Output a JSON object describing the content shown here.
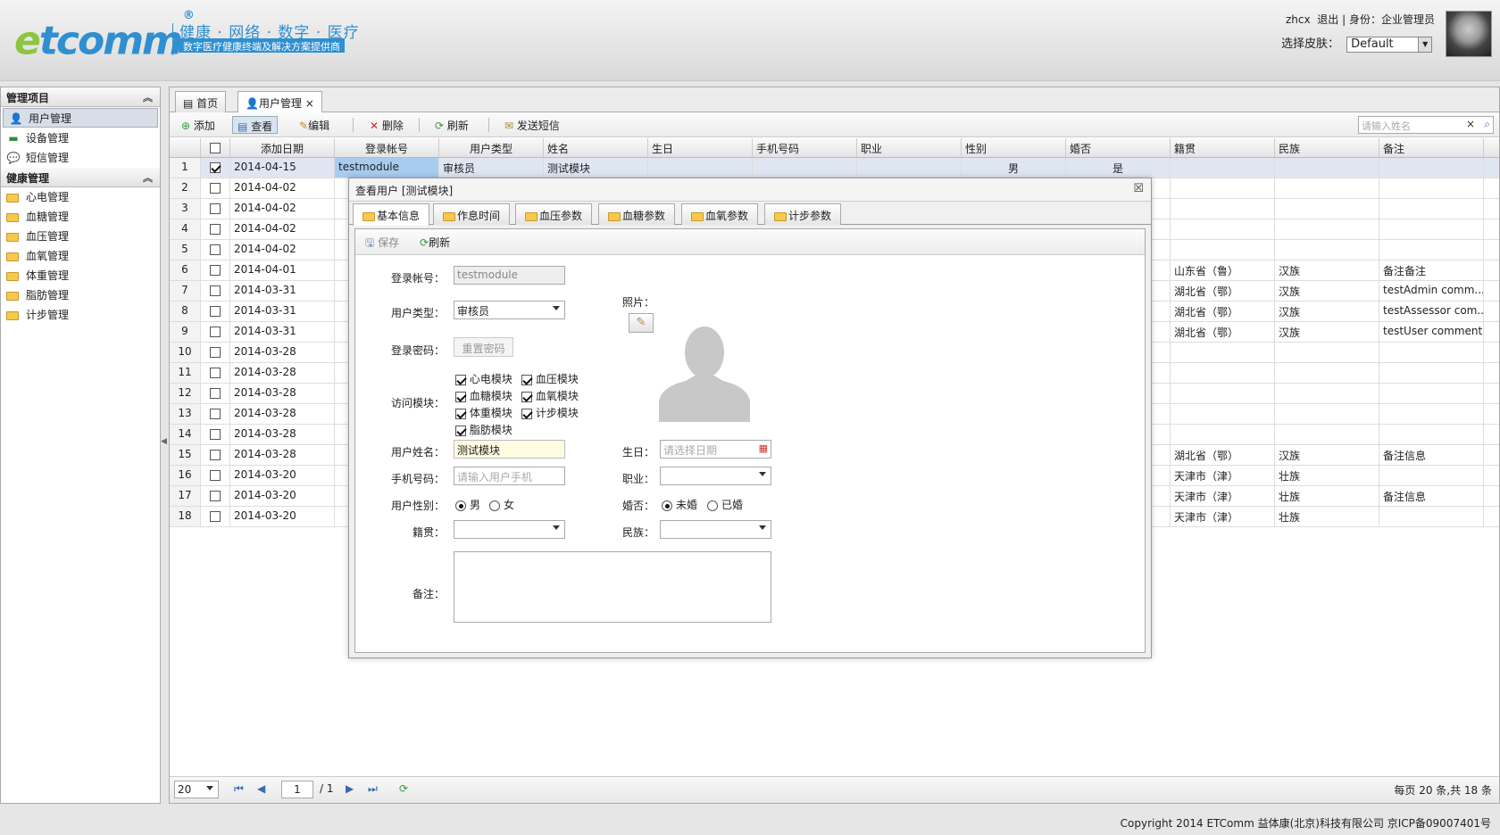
{
  "header": {
    "logo": {
      "e": "e",
      "rest": "tcomm",
      "reg": "®"
    },
    "slogan": "健康 · 网络 · 数字 · 医疗",
    "subslogan": "数字医疗健康终端及解决方案提供商",
    "username": "zhcx",
    "logout": "退出",
    "role_sep": "|",
    "role": "身份：企业管理员",
    "skin_label": "选择皮肤：",
    "skin_value": "Default"
  },
  "sidebar": {
    "section1": {
      "title": "管理项目",
      "items": [
        {
          "label": "用户管理",
          "icon": "user-icon"
        },
        {
          "label": "设备管理",
          "icon": "device-icon"
        },
        {
          "label": "短信管理",
          "icon": "sms-icon"
        }
      ]
    },
    "section2": {
      "title": "健康管理",
      "items": [
        {
          "label": "心电管理"
        },
        {
          "label": "血糖管理"
        },
        {
          "label": "血压管理"
        },
        {
          "label": "血氧管理"
        },
        {
          "label": "体重管理"
        },
        {
          "label": "脂肪管理"
        },
        {
          "label": "计步管理"
        }
      ]
    }
  },
  "tabs": [
    {
      "label": "首页"
    },
    {
      "label": "用户管理",
      "close": "×"
    }
  ],
  "toolbar": {
    "add": "添加",
    "view": "查看",
    "edit": "编辑",
    "delete": "删除",
    "refresh": "刷新",
    "sms": "发送短信",
    "search_placeholder": "请输入姓名",
    "clear": "×"
  },
  "grid": {
    "columns": [
      "添加日期",
      "登录帐号",
      "用户类型",
      "姓名",
      "生日",
      "手机号码",
      "职业",
      "性别",
      "婚否",
      "籍贯",
      "民族",
      "备注"
    ],
    "rows": [
      {
        "n": "1",
        "date": "2014-04-15",
        "account": "testmodule",
        "type": "审核员",
        "name": "测试模块",
        "gender": "男",
        "married": "是",
        "origin": "",
        "ethnic": "",
        "note": "",
        "checked": true
      },
      {
        "n": "2",
        "date": "2014-04-02",
        "origin": "",
        "ethnic": "",
        "note": ""
      },
      {
        "n": "3",
        "date": "2014-04-02",
        "origin": "",
        "ethnic": "",
        "note": ""
      },
      {
        "n": "4",
        "date": "2014-04-02",
        "origin": "",
        "ethnic": "",
        "note": ""
      },
      {
        "n": "5",
        "date": "2014-04-02",
        "origin": "",
        "ethnic": "",
        "note": ""
      },
      {
        "n": "6",
        "date": "2014-04-01",
        "origin": "山东省（鲁）",
        "ethnic": "汉族",
        "note": "备注备注"
      },
      {
        "n": "7",
        "date": "2014-03-31",
        "origin": "湖北省（鄂）",
        "ethnic": "汉族",
        "note": "testAdmin comm..."
      },
      {
        "n": "8",
        "date": "2014-03-31",
        "origin": "湖北省（鄂）",
        "ethnic": "汉族",
        "note": "testAssessor com..."
      },
      {
        "n": "9",
        "date": "2014-03-31",
        "origin": "湖北省（鄂）",
        "ethnic": "汉族",
        "note": "testUser comment"
      },
      {
        "n": "10",
        "date": "2014-03-28",
        "origin": "",
        "ethnic": "",
        "note": ""
      },
      {
        "n": "11",
        "date": "2014-03-28",
        "origin": "",
        "ethnic": "",
        "note": ""
      },
      {
        "n": "12",
        "date": "2014-03-28",
        "origin": "",
        "ethnic": "",
        "note": ""
      },
      {
        "n": "13",
        "date": "2014-03-28",
        "origin": "",
        "ethnic": "",
        "note": ""
      },
      {
        "n": "14",
        "date": "2014-03-28",
        "origin": "",
        "ethnic": "",
        "note": ""
      },
      {
        "n": "15",
        "date": "2014-03-28",
        "origin": "湖北省（鄂）",
        "ethnic": "汉族",
        "note": "备注信息"
      },
      {
        "n": "16",
        "date": "2014-03-20",
        "origin": "天津市（津）",
        "ethnic": "壮族",
        "note": ""
      },
      {
        "n": "17",
        "date": "2014-03-20",
        "origin": "天津市（津）",
        "ethnic": "壮族",
        "note": "备注信息"
      },
      {
        "n": "18",
        "date": "2014-03-20",
        "origin": "天津市（津）",
        "ethnic": "壮族",
        "note": ""
      }
    ]
  },
  "pager": {
    "page_size": "20",
    "current_page": "1",
    "total_pages": "/ 1",
    "summary": "每页 20 条,共 18 条"
  },
  "dialog": {
    "title": "查看用户 [测试模块]",
    "close": "☒",
    "tabs": [
      "基本信息",
      "作息时间",
      "血压参数",
      "血糖参数",
      "血氧参数",
      "计步参数"
    ],
    "save": "保存",
    "refresh": "刷新",
    "account_label": "登录帐号：",
    "account_value": "testmodule",
    "type_label": "用户类型：",
    "type_value": "审核员",
    "photo_label": "照片：",
    "password_label": "登录密码：",
    "reset_password": "重置密码",
    "modules_label": "访问模块：",
    "modules": [
      "心电模块",
      "血压模块",
      "血糖模块",
      "血氧模块",
      "体重模块",
      "计步模块",
      "脂肪模块"
    ],
    "name_label": "用户姓名：",
    "name_value": "测试模块",
    "birthday_label": "生日：",
    "birthday_placeholder": "请选择日期",
    "phone_label": "手机号码：",
    "phone_placeholder": "请输入用户手机",
    "job_label": "职业：",
    "gender_label": "用户性别：",
    "gender_male": "男",
    "gender_female": "女",
    "married_label": "婚否：",
    "married_no": "未婚",
    "married_yes": "已婚",
    "origin_label": "籍贯：",
    "ethnic_label": "民族：",
    "note_label": "备注："
  },
  "footer": {
    "text": "Copyright 2014 ETComm 益体康(北京)科技有限公司   京ICP备09007401号"
  }
}
